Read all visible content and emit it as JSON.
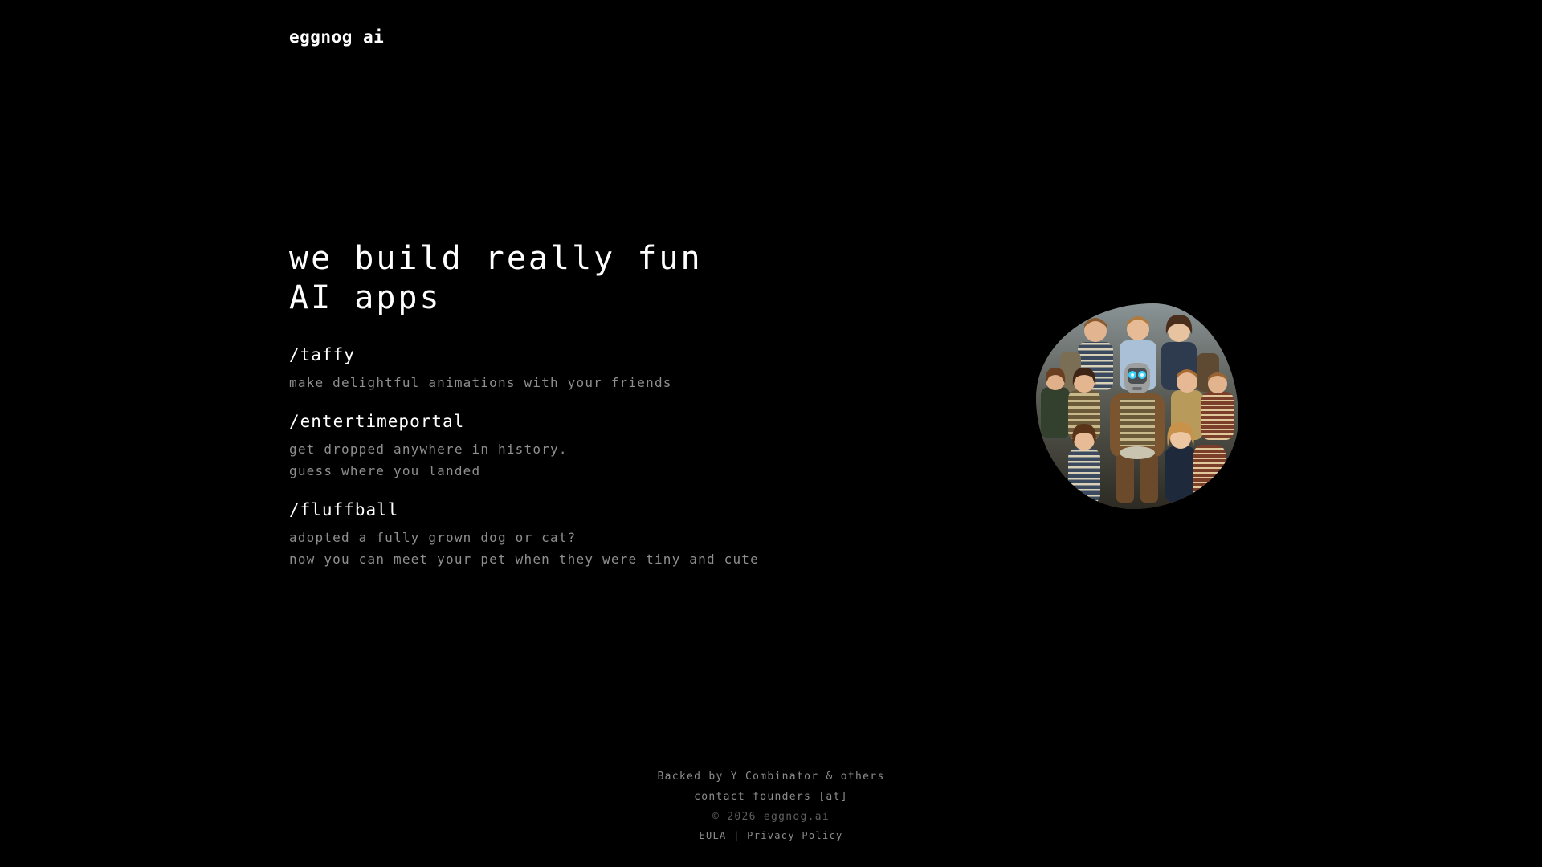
{
  "header": {
    "logo_text": "eggnog ai"
  },
  "hero": {
    "title_line1": "we build really fun",
    "title_line2": "AI apps"
  },
  "apps": [
    {
      "name": "/taffy",
      "desc_lines": [
        "make delightful animations with your friends"
      ]
    },
    {
      "name": "/entertimeportal",
      "desc_lines": [
        "get dropped anywhere in history.",
        "guess where you landed"
      ]
    },
    {
      "name": "/fluffball",
      "desc_lines": [
        "adopted a fully grown dog or cat?",
        "now you can meet your pet when they were tiny and cute"
      ]
    }
  ],
  "footer": {
    "backed": "Backed by Y Combinator & others",
    "contact": "contact founders [at]",
    "copyright": "© 2026 eggnog.ai",
    "eula": "EULA",
    "separator": "|",
    "privacy": "Privacy Policy"
  },
  "colors": {
    "background": "#000000",
    "text": "#ffffff",
    "muted": "#8f8f8f"
  }
}
